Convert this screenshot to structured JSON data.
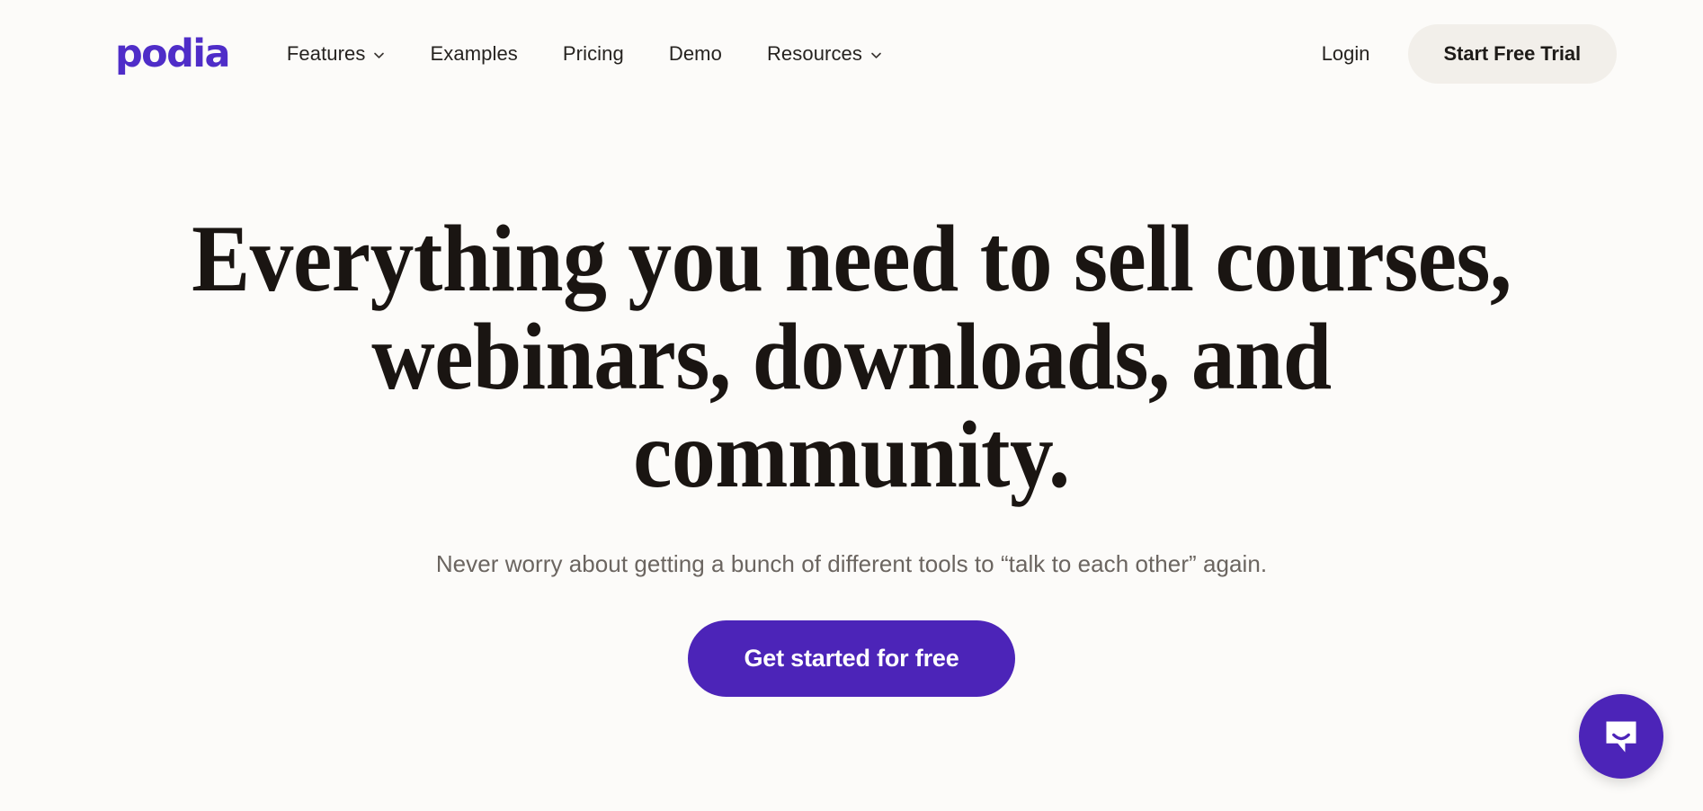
{
  "page": {
    "background_color": "#fcfbf9",
    "accent_purple": "#4c24b8",
    "logo_purple": "#4f2dc8",
    "heading_color": "#1a1512",
    "muted_text_color": "#6b6560",
    "pill_background": "#f2efea"
  },
  "header": {
    "logo_text": "podia",
    "nav_items": [
      {
        "label": "Features",
        "has_dropdown": true,
        "icon": "chevron-down-icon"
      },
      {
        "label": "Examples",
        "has_dropdown": false,
        "icon": ""
      },
      {
        "label": "Pricing",
        "has_dropdown": false,
        "icon": ""
      },
      {
        "label": "Demo",
        "has_dropdown": false,
        "icon": ""
      },
      {
        "label": "Resources",
        "has_dropdown": true,
        "icon": "chevron-down-icon"
      }
    ],
    "login_label": "Login",
    "trial_button_label": "Start Free Trial"
  },
  "hero": {
    "title_lines": [
      "Everything you need to sell courses,",
      "webinars, downloads, and",
      "community."
    ],
    "subtitle": "Never worry about getting a bunch of different tools to “talk to each other” again.",
    "cta_label": "Get started for free"
  },
  "chat_widget": {
    "icon": "chat-bubble-smile-icon",
    "aria_label": "Open Intercom Messenger"
  }
}
